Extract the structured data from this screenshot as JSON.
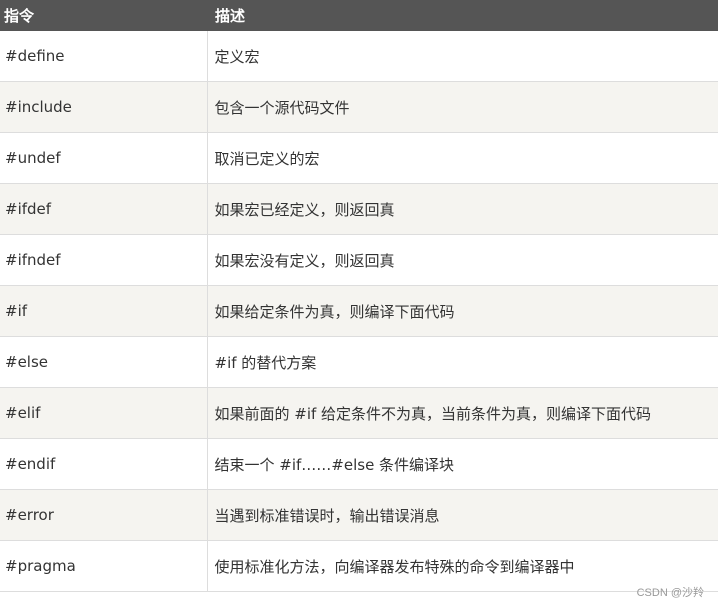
{
  "header": {
    "directive": "指令",
    "description": "描述"
  },
  "rows": [
    {
      "directive": "#define",
      "description": "定义宏"
    },
    {
      "directive": "#include",
      "description": "包含一个源代码文件"
    },
    {
      "directive": "#undef",
      "description": "取消已定义的宏"
    },
    {
      "directive": "#ifdef",
      "description": "如果宏已经定义，则返回真"
    },
    {
      "directive": "#ifndef",
      "description": "如果宏没有定义，则返回真"
    },
    {
      "directive": "#if",
      "description": "如果给定条件为真，则编译下面代码"
    },
    {
      "directive": "#else",
      "description": "#if 的替代方案"
    },
    {
      "directive": "#elif",
      "description": "如果前面的 #if 给定条件不为真，当前条件为真，则编译下面代码"
    },
    {
      "directive": "#endif",
      "description": "结束一个 #if……#else 条件编译块"
    },
    {
      "directive": "#error",
      "description": "当遇到标准错误时，输出错误消息"
    },
    {
      "directive": "#pragma",
      "description": "使用标准化方法，向编译器发布特殊的命令到编译器中"
    }
  ],
  "watermark": "CSDN @沙羚"
}
